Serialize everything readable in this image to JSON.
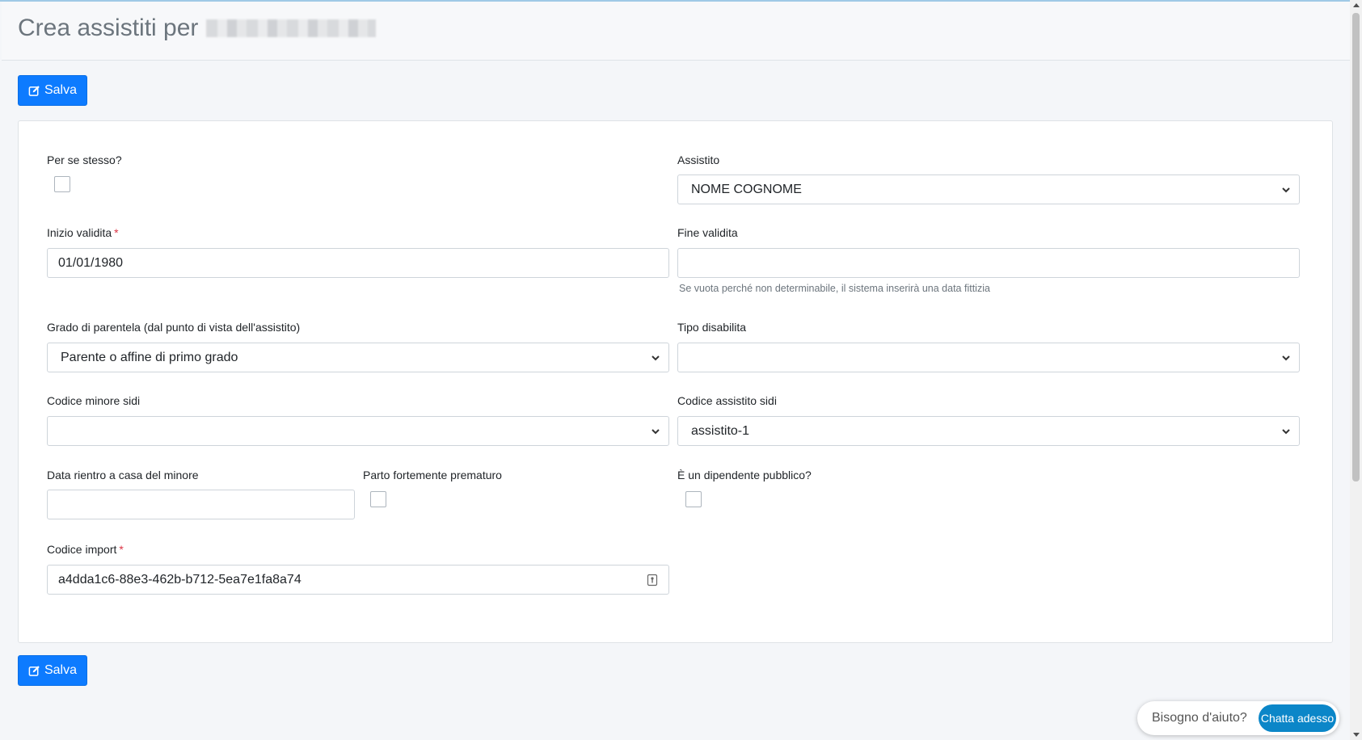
{
  "header": {
    "title": "Crea assistiti per"
  },
  "toolbar": {
    "save_label": "Salva",
    "save_icon": "edit-icon"
  },
  "form": {
    "per_se_stesso": {
      "label": "Per se stesso?",
      "checked": false
    },
    "assistito": {
      "label": "Assistito",
      "value": "NOME COGNOME"
    },
    "inizio_validita": {
      "label": "Inizio validita",
      "required_mark": "*",
      "value": "01/01/1980"
    },
    "fine_validita": {
      "label": "Fine validita",
      "value": "",
      "help": "Se vuota perché non determinabile, il sistema inserirà una data fittizia"
    },
    "grado_parentela": {
      "label": "Grado di parentela (dal punto di vista dell'assistito)",
      "value": "Parente o affine di primo grado"
    },
    "tipo_disabilita": {
      "label": "Tipo disabilita",
      "value": ""
    },
    "codice_minore_sidi": {
      "label": "Codice minore sidi",
      "value": ""
    },
    "codice_assistito_sidi": {
      "label": "Codice assistito sidi",
      "value": "assistito-1"
    },
    "data_rientro": {
      "label": "Data rientro a casa del minore",
      "value": ""
    },
    "parto_prematuro": {
      "label": "Parto fortemente prematuro",
      "checked": false
    },
    "dipendente_pubblico": {
      "label": "È un dipendente pubblico?",
      "checked": false
    },
    "codice_import": {
      "label": "Codice import",
      "required_mark": "*",
      "value": "a4dda1c6-88e3-462b-b712-5ea7e1fa8a74"
    }
  },
  "chat_widget": {
    "prompt": "Bisogno d'aiuto?",
    "button_label": "Chatta adesso"
  },
  "colors": {
    "primary": "#0d7bff",
    "required": "#dc3545",
    "chat": "#0b86c8"
  }
}
